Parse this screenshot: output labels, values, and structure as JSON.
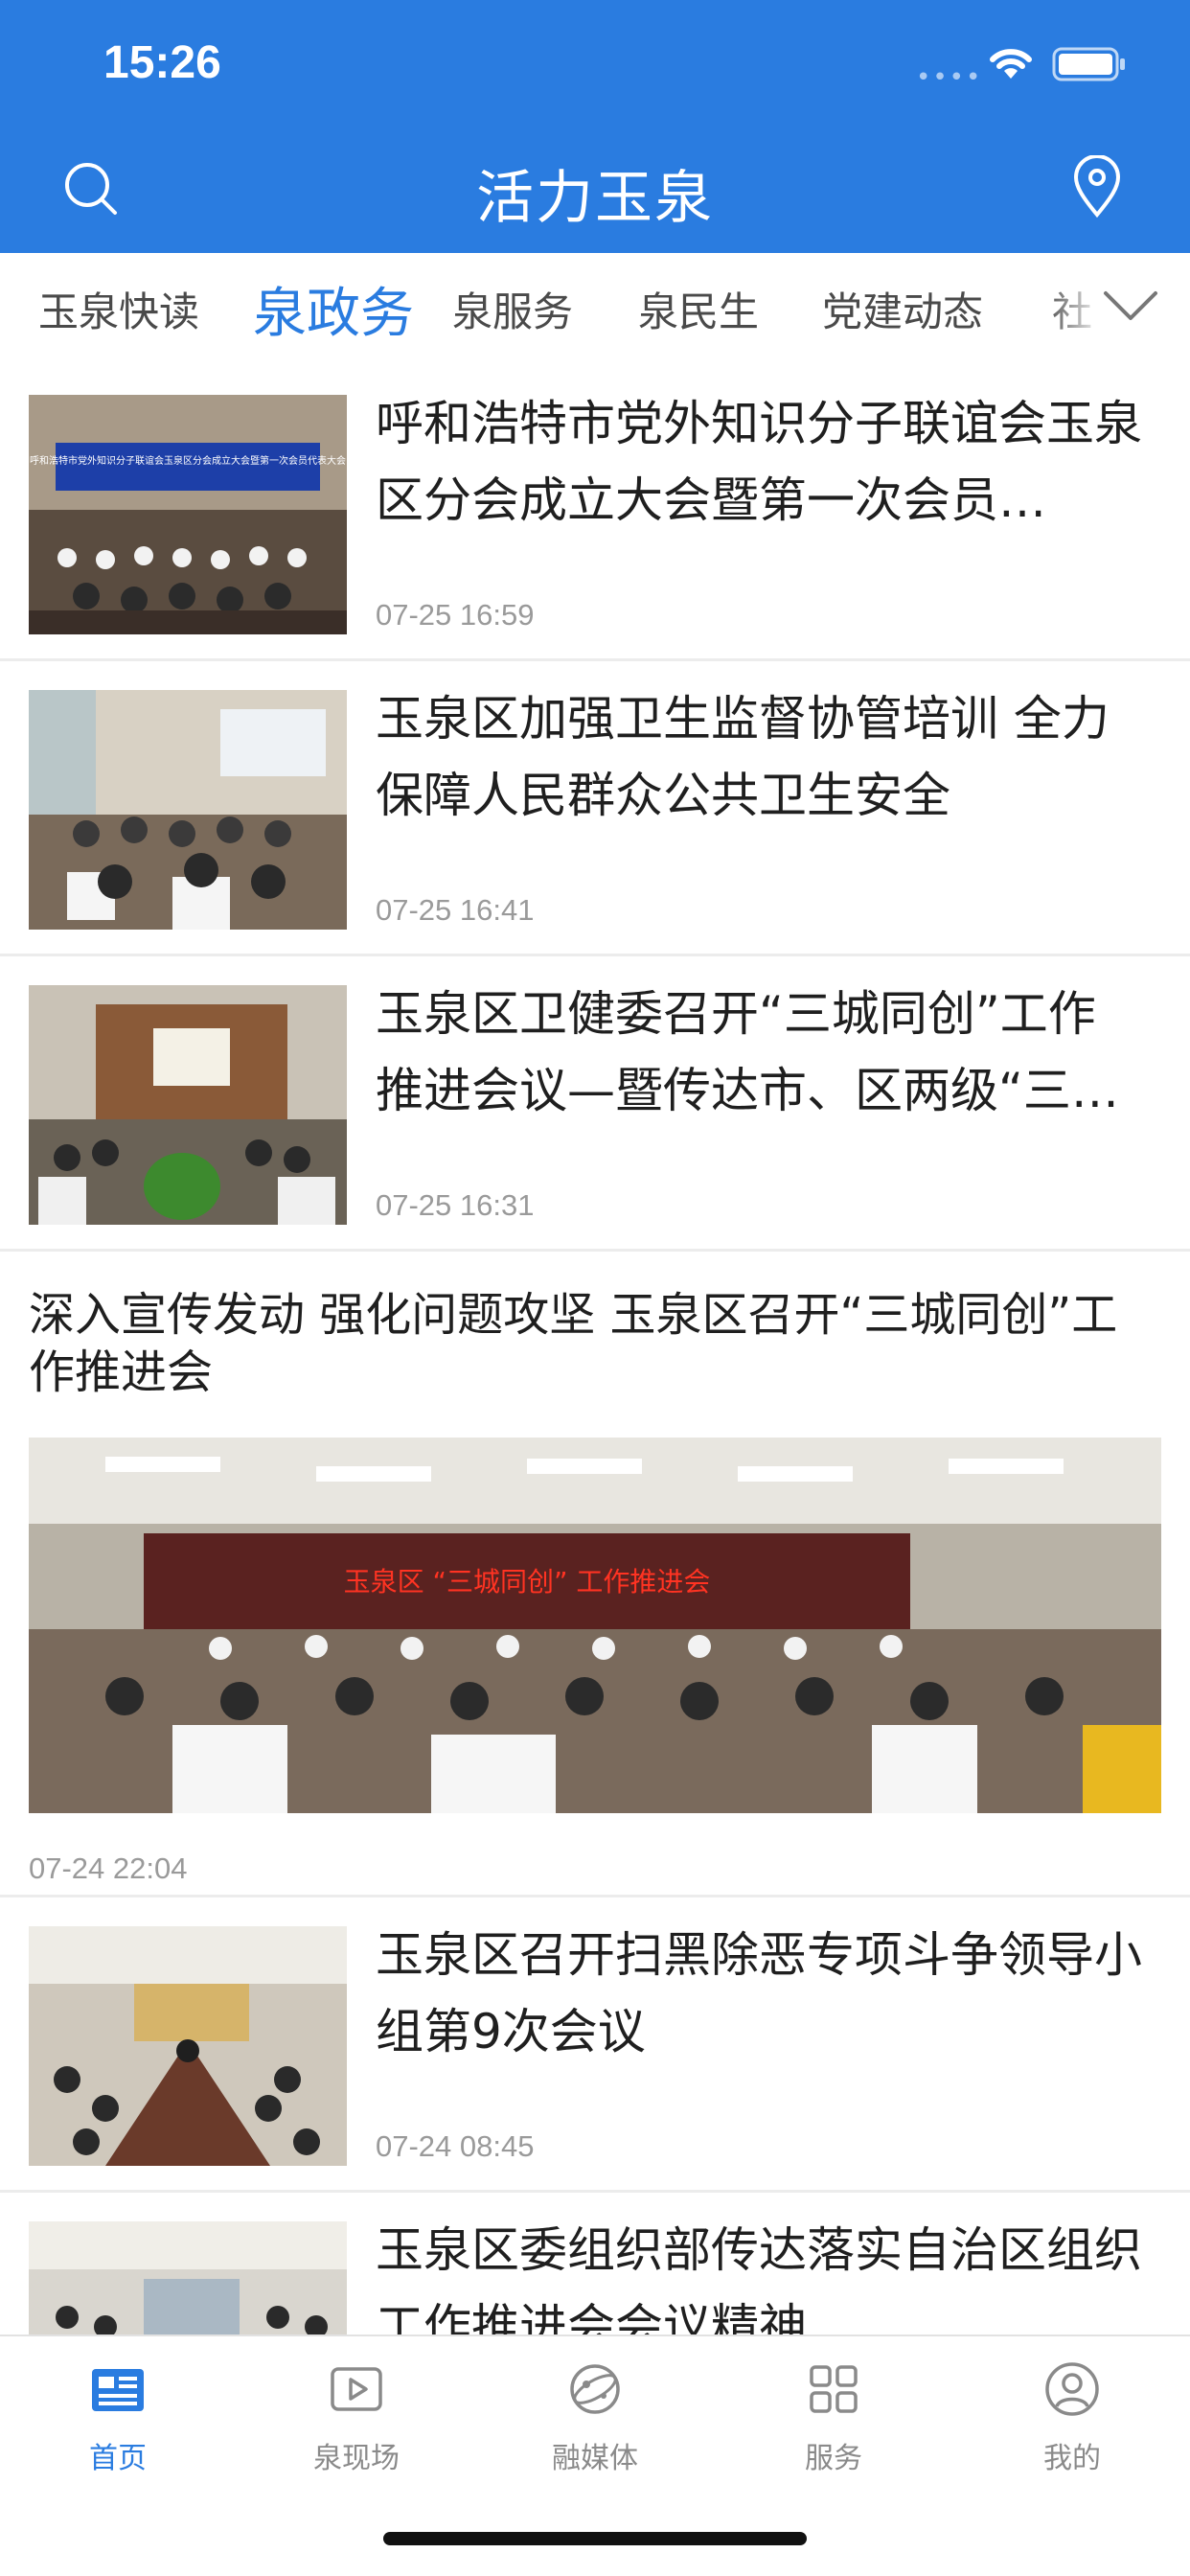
{
  "status_bar": {
    "time": "15:26",
    "signal": "••••"
  },
  "header": {
    "title": "活力玉泉"
  },
  "tabs": [
    {
      "label": "玉泉快读",
      "active": false
    },
    {
      "label": "泉政务",
      "active": true
    },
    {
      "label": "泉服务",
      "active": false
    },
    {
      "label": "泉民生",
      "active": false
    },
    {
      "label": "党建动态",
      "active": false
    },
    {
      "label": "社",
      "active": false
    }
  ],
  "news": [
    {
      "title": "呼和浩特市党外知识分子联谊会玉泉区分会成立大会暨第一次会员…",
      "time": "07-25 16:59",
      "thumb_banner": "呼和浩特市党外知识分子联谊会玉泉区分会成立大会暨第一次会员代表大会"
    },
    {
      "title": "玉泉区加强卫生监督协管培训 全力保障人民群众公共卫生安全",
      "time": "07-25 16:41"
    },
    {
      "title": "玉泉区卫健委召开“三城同创”工作推进会议—暨传达市、区两级“三…",
      "time": "07-25 16:31"
    },
    {
      "title": "深入宣传发动 强化问题攻坚 玉泉区召开“三城同创”工作推进会",
      "time": "07-24 22:04",
      "banner": "玉泉区 “三城同创” 工作推进会"
    },
    {
      "title": "玉泉区召开扫黑除恶专项斗争领导小组第9次会议",
      "time": "07-24 08:45"
    },
    {
      "title": "玉泉区委组织部传达落实自治区组织工作推进会会议精神",
      "time": ""
    }
  ],
  "bottom_nav": [
    {
      "label": "首页",
      "icon": "news-icon",
      "active": true
    },
    {
      "label": "泉现场",
      "icon": "play-icon",
      "active": false
    },
    {
      "label": "融媒体",
      "icon": "globe-icon",
      "active": false
    },
    {
      "label": "服务",
      "icon": "grid-icon",
      "active": false
    },
    {
      "label": "我的",
      "icon": "user-icon",
      "active": false
    }
  ],
  "colors": {
    "primary": "#2a7ce0",
    "text": "#1f1f1f",
    "muted": "#9a9a9a"
  }
}
